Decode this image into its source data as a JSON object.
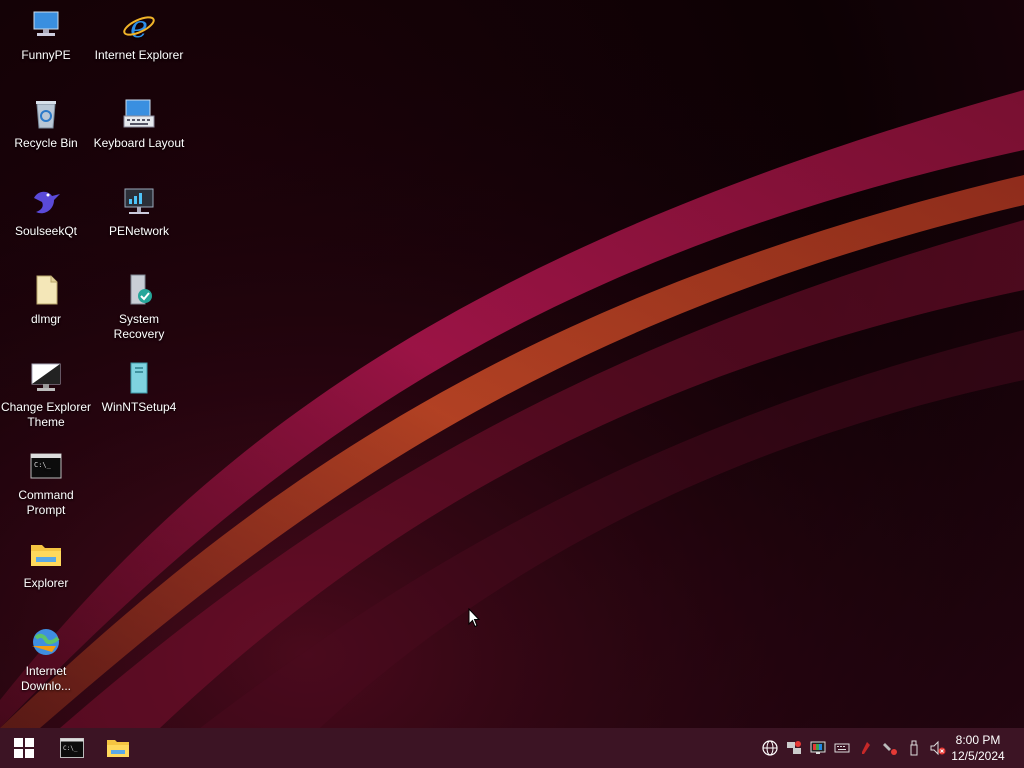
{
  "desktop": {
    "icons": [
      {
        "label": "FunnyPE",
        "icon": "computer-icon"
      },
      {
        "label": "Internet Explorer",
        "icon": "internet-explorer-icon"
      },
      {
        "label": "Recycle Bin",
        "icon": "recycle-bin-icon"
      },
      {
        "label": "Keyboard Layout",
        "icon": "keyboard-icon"
      },
      {
        "label": "SoulseekQt",
        "icon": "bird-icon"
      },
      {
        "label": "PENetwork",
        "icon": "network-monitor-icon"
      },
      {
        "label": "dlmgr",
        "icon": "file-icon"
      },
      {
        "label": "System Recovery",
        "icon": "recovery-icon"
      },
      {
        "label": "Change Explorer Theme",
        "icon": "monitor-icon"
      },
      {
        "label": "WinNTSetup4",
        "icon": "setup-icon"
      },
      {
        "label": "Command Prompt",
        "icon": "console-icon"
      },
      {
        "label": "Explorer",
        "icon": "folder-icon"
      },
      {
        "label": "Internet Downlo...",
        "icon": "download-globe-icon"
      }
    ]
  },
  "taskbar": {
    "start_icon": "windows-logo-icon",
    "pinned": [
      "console-icon",
      "folder-icon"
    ],
    "tray_icons": [
      "globe-icon",
      "network-icon",
      "color-icon",
      "keyboard-icon",
      "pen-icon",
      "safely-remove-icon",
      "usb-icon",
      "volume-muted-icon"
    ],
    "clock": {
      "time": "8:00 PM",
      "date": "12/5/2024"
    }
  },
  "colors": {
    "taskbar": "#3c1424",
    "wallpaper_dark": "#1a0208",
    "wallpaper_accent": "#c2185b",
    "wallpaper_orange": "#e0552a"
  }
}
